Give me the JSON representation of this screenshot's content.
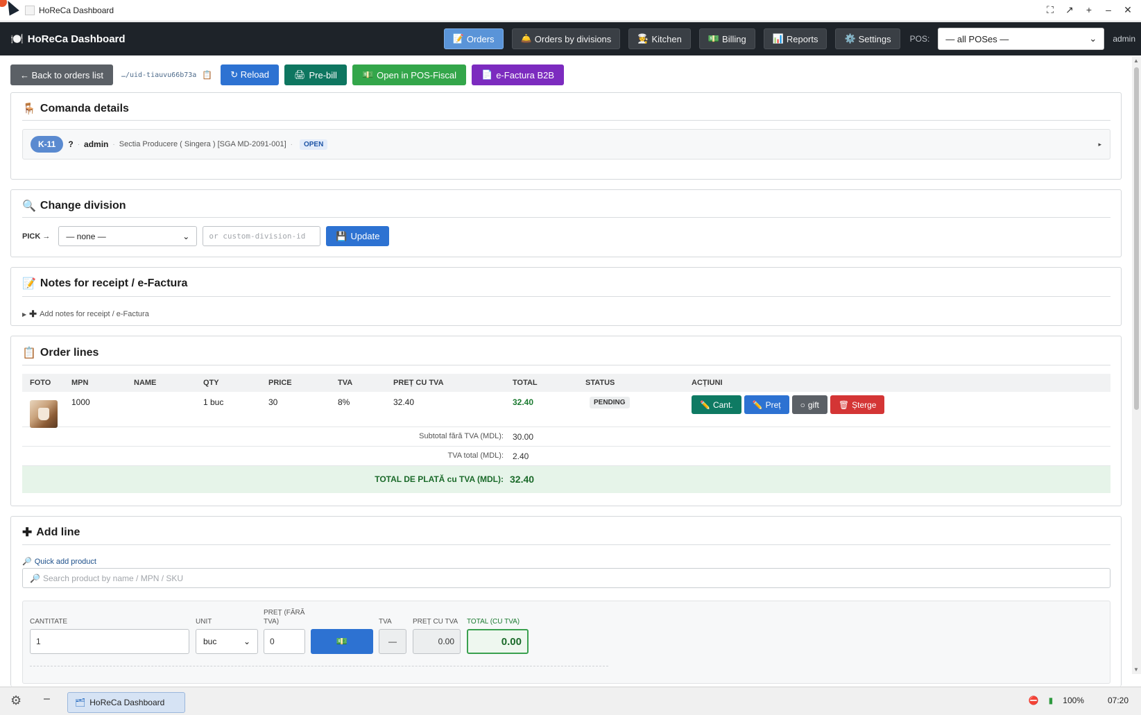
{
  "window": {
    "title": "HoReCa Dashboard"
  },
  "brand": {
    "icon": "🍽️",
    "label": "HoReCa Dashboard"
  },
  "nav": [
    {
      "label": "Orders",
      "icon": "📝",
      "active": true
    },
    {
      "label": "Orders by divisions",
      "icon": "🛎️",
      "active": false
    },
    {
      "label": "Kitchen",
      "icon": "🧑‍🍳",
      "active": false
    },
    {
      "label": "Billing",
      "icon": "💵",
      "active": false
    },
    {
      "label": "Reports",
      "icon": "📊",
      "active": false
    },
    {
      "label": "Settings",
      "icon": "⚙️",
      "active": false
    }
  ],
  "pos": {
    "label": "POS:",
    "selected": "— all POSes —"
  },
  "user": "admin",
  "toolbar": {
    "back": "← Back to orders list",
    "uid": "…/uid-tiauvu66b73a",
    "reload": "↻ Reload",
    "prebill": "Pre-bill",
    "open_pos": "Open in POS-Fiscal",
    "efactura": "e-Factura B2B"
  },
  "comanda": {
    "title": "Comanda details",
    "table": "K-11",
    "unknown": "?",
    "user": "admin",
    "division": "Sectia Producere ( Singera ) [SGA MD-2091-001]",
    "status": "OPEN"
  },
  "division": {
    "title": "Change division",
    "pick_label": "PICK →",
    "select_value": "— none —",
    "custom_placeholder": "or custom-division-id",
    "update": "Update"
  },
  "notes": {
    "title": "Notes for receipt / e-Factura",
    "toggle": "Add notes for receipt / e-Factura"
  },
  "order_lines": {
    "title": "Order lines",
    "headers": [
      "FOTO",
      "MPN",
      "NAME",
      "QTY",
      "PRICE",
      "TVA",
      "PREȚ CU TVA",
      "TOTAL",
      "STATUS",
      "ACȚIUNI"
    ],
    "rows": [
      {
        "mpn": "1000",
        "name": "",
        "qty": "1 buc",
        "price": "30",
        "tva": "8%",
        "price_tva": "32.40",
        "total": "32.40",
        "status": "PENDING"
      }
    ],
    "actions": {
      "qty": "Cant.",
      "price": "Preț",
      "gift": "gift",
      "delete": "Șterge"
    },
    "subtotal_label": "Subtotal fără TVA (MDL):",
    "subtotal": "30.00",
    "tva_label": "TVA total (MDL):",
    "tva_total": "2.40",
    "grand_label": "TOTAL DE PLATĂ cu TVA (MDL):",
    "grand_total": "32.40"
  },
  "add_line": {
    "title": "Add line",
    "quick_label": "Quick add product",
    "search_placeholder": "Search product by name / MPN / SKU",
    "qty_label": "CANTITATE",
    "qty_value": "1",
    "unit_label": "UNIT",
    "unit_value": "buc",
    "price_label": "PREȚ (FĂRĂ TVA)",
    "price_value": "0",
    "tva_label": "TVA",
    "tva_value": "—",
    "price_tva_label": "PREȚ CU TVA",
    "price_tva_value": "0.00",
    "total_label": "TOTAL (CU TVA)",
    "total_value": "0.00"
  },
  "taskbar": {
    "app": "HoReCa Dashboard",
    "battery": "100%",
    "time": "07:20"
  }
}
